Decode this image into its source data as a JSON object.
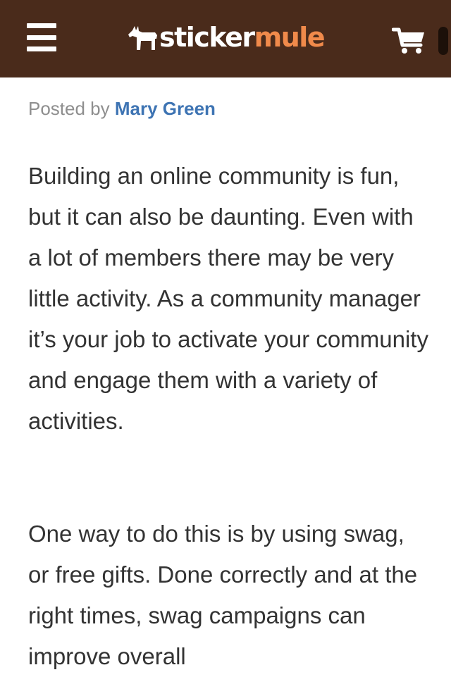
{
  "header": {
    "menu_icon": "hamburger-menu-icon",
    "logo": {
      "part1": "sticker",
      "part2": "mule",
      "icon": "mule-icon"
    },
    "cart_icon": "shopping-cart-icon",
    "colors": {
      "bar": "#4a2b1b",
      "logo_accent": "#f08a4b"
    }
  },
  "post": {
    "posted_by_label": "Posted by",
    "author": "Mary Green",
    "author_color": "#3e74b3",
    "paragraphs": [
      "Building an online community is fun, but it can also be daunting. Even with a lot of members there may be very little activity. As a community manager it’s your job to activate your community and engage them with a variety of activities.",
      "One way to do this is by using swag, or free gifts. Done correctly and at the right times, swag campaigns can improve overall"
    ]
  }
}
